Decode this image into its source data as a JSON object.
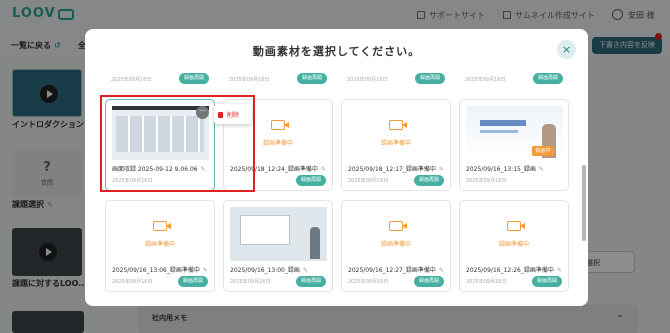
{
  "app": {
    "logo": "LOOV"
  },
  "header": {
    "support_link": "サポートサイト",
    "thumbnail_link": "サムネイル作成サイト",
    "user_name": "安田 様"
  },
  "toolbar": {
    "back_label": "一覧に戻る",
    "back_all_label": "全",
    "reflect_label": "下書き内容を反映"
  },
  "sidebar": {
    "intro_label": "イントロダクション",
    "question_mark": "?",
    "question_sub": "質問",
    "topic_label": "課題選択",
    "loo_label": "課題に対するLOO..."
  },
  "select": {
    "value": "選択"
  },
  "memo": {
    "label": "社内用メモ"
  },
  "modal": {
    "title": "動画素材を選択してください。",
    "close_label": "×",
    "top_row": [
      {
        "date": "2025年09月16日",
        "button": "録画再開"
      },
      {
        "date": "2025年09月16日",
        "button": "録画再開"
      },
      {
        "date": "2025年09月16日",
        "button": "録画再開"
      },
      {
        "date": "2025年09月16日",
        "button": "録画再開"
      }
    ],
    "cards": [
      {
        "title": "画面収録 2025-09-12 9.06.06",
        "date": "2025年09月16日",
        "button": ""
      },
      {
        "title": "2025/09/18_12:24_録画準備中",
        "date": "",
        "button": "録画再開",
        "status": "録画準備中"
      },
      {
        "title": "2025/09/18_12:17_録画準備中",
        "date": "2025年09月16日",
        "button": "録画再開",
        "status": "録画準備中"
      },
      {
        "title": "2025/09/16_13:15_録画",
        "date": "2025年09月16日",
        "button": "",
        "badge": "録画中"
      },
      {
        "title": "2025/09/16_13:06_録画準備中",
        "date": "2025年09月16日",
        "button": "録画再開",
        "status": "録画準備中"
      },
      {
        "title": "2025/09/16_13:00_録画",
        "date": "2025年09月16日",
        "button": "録画再開"
      },
      {
        "title": "2025/09/16_12:27_録画準備中",
        "date": "2025年09月16日",
        "button": "録画再開",
        "status": "録画準備中"
      },
      {
        "title": "2025/09/16_12:26_録画準備中",
        "date": "2025年09月16日",
        "button": "録画再開",
        "status": "録画準備中"
      }
    ],
    "more_label": "···",
    "delete_label": "削除"
  },
  "colors": {
    "accent": "#45b0a2",
    "highlight": "#e02020",
    "prep": "#f39a3a"
  }
}
